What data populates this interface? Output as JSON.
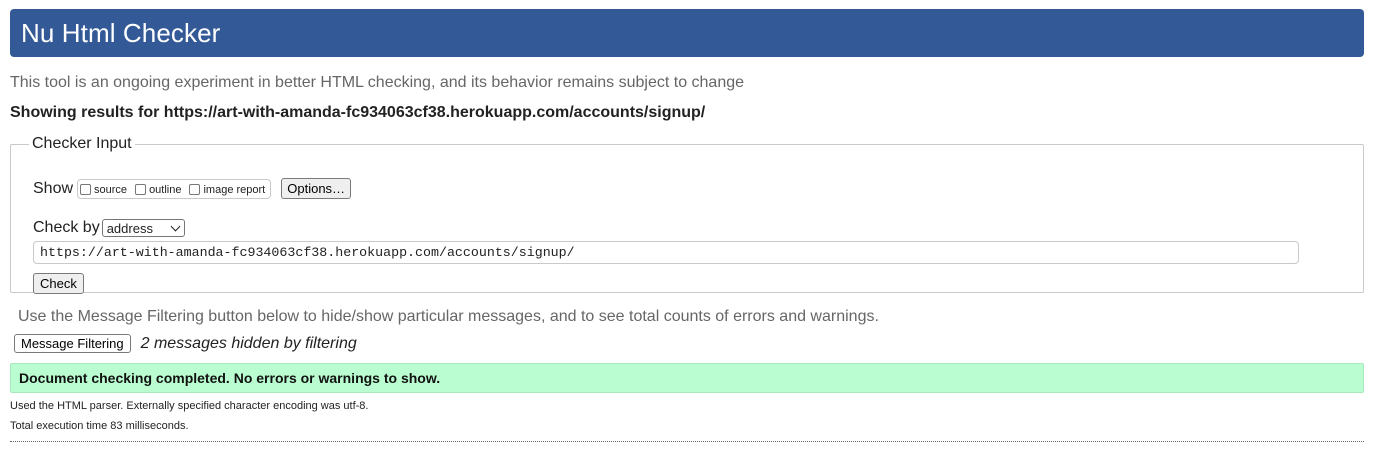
{
  "header": {
    "title": "Nu Html Checker"
  },
  "tagline": "This tool is an ongoing experiment in better HTML checking, and its behavior remains subject to change",
  "results_for": "Showing results for https://art-with-amanda-fc934063cf38.herokuapp.com/accounts/signup/",
  "checker_input": {
    "legend": "Checker Input",
    "show_label": "Show",
    "show_options": [
      {
        "label": "source",
        "checked": false
      },
      {
        "label": "outline",
        "checked": false
      },
      {
        "label": "image report",
        "checked": false
      }
    ],
    "options_button": "Options…",
    "check_by_label": "Check by",
    "check_by_value": "address",
    "url_value": "https://art-with-amanda-fc934063cf38.herokuapp.com/accounts/signup/",
    "check_button": "Check"
  },
  "filtering": {
    "note": "Use the Message Filtering button below to hide/show particular messages, and to see total counts of errors and warnings.",
    "button": "Message Filtering",
    "hidden_note": "2 messages hidden by filtering"
  },
  "result": {
    "message": "Document checking completed. No errors or warnings to show.",
    "parser_note": "Used the HTML parser. Externally specified character encoding was utf-8.",
    "time_note": "Total execution time 83 milliseconds."
  },
  "colors": {
    "header_bg": "#335a97",
    "success_bg": "#b9fdd0"
  }
}
